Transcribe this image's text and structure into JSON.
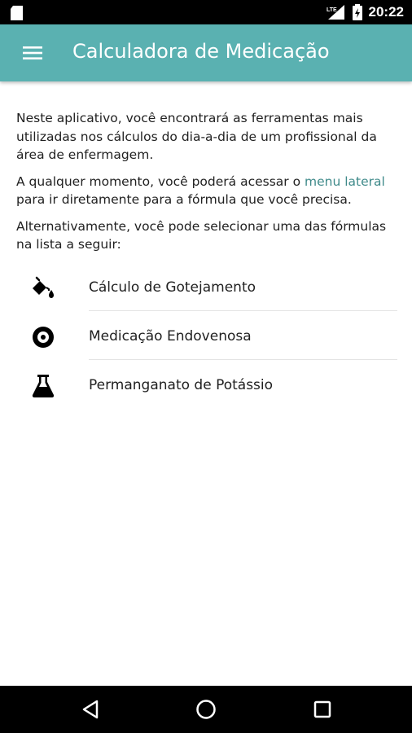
{
  "status_bar": {
    "time": "20:22",
    "left_icon": "sd-card-icon",
    "network_label": "LTE"
  },
  "app_bar": {
    "title": "Calculadora de Medicação",
    "menu_icon": "hamburger-menu-icon",
    "color": "#5ab1b1"
  },
  "intro": {
    "para1": "Neste aplicativo, você encontrará as ferramentas mais utilizadas nos cálculos do dia-a-dia de um profissional da área de enfermagem.",
    "para2_before": "A qualquer momento, você poderá acessar o ",
    "para2_link": "menu lateral",
    "para2_after": " para ir diretamente para a fórmula que você precisa.",
    "para3": "Alternativamente, você pode selecionar uma das fórmulas na lista a seguir:"
  },
  "formulas": [
    {
      "label": "Cálculo de Gotejamento",
      "icon": "drip-bucket-icon"
    },
    {
      "label": "Medicação Endovenosa",
      "icon": "disc-icon"
    },
    {
      "label": "Permanganato de Potássio",
      "icon": "flask-icon"
    }
  ],
  "nav_bar": {
    "back_icon": "back-triangle-icon",
    "home_icon": "home-circle-icon",
    "recents_icon": "recents-square-icon"
  },
  "colors": {
    "accent": "#5ab1b1",
    "link": "#3f8a8a"
  }
}
